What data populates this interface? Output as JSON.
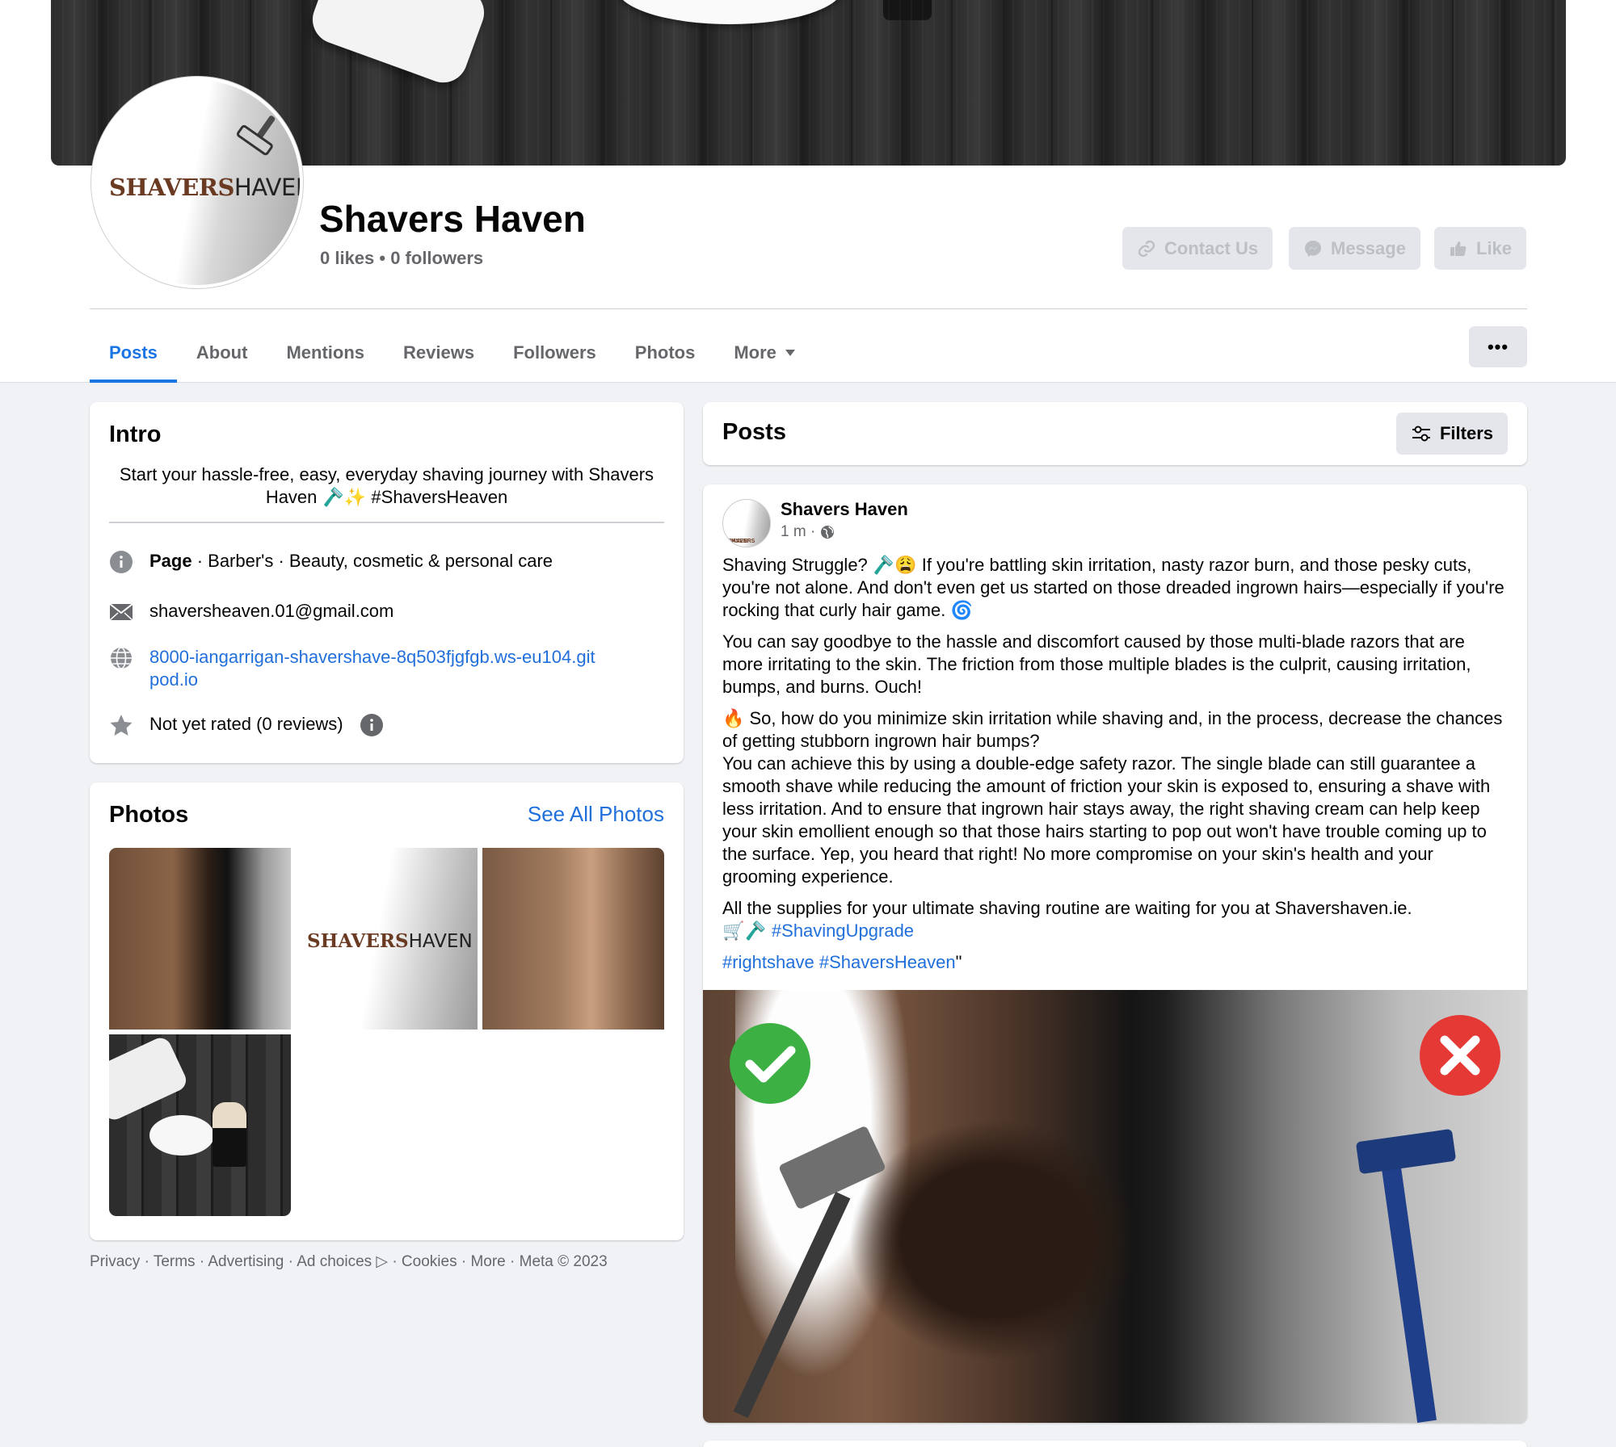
{
  "page": {
    "name": "Shavers Haven",
    "stats": "0 likes • 0 followers",
    "logo_text_1": "SHAVERS",
    "logo_text_2": "HAVEN"
  },
  "actions": {
    "contact": "Contact Us",
    "message": "Message",
    "like": "Like"
  },
  "tabs": [
    "Posts",
    "About",
    "Mentions",
    "Reviews",
    "Followers",
    "Photos",
    "More"
  ],
  "more_menu": "•••",
  "intro": {
    "title": "Intro",
    "bio": "Start your hassle-free, easy, everyday shaving journey with Shavers Haven 🪒✨ #ShaversHeaven",
    "category_label": "Page",
    "category": " · Barber's · Beauty, cosmetic & personal care",
    "email": "shaversheaven.01@gmail.com",
    "website": "8000-iangarrigan-shavershave-8q503fjgfgb.ws-eu104.gitpod.io",
    "rating": "Not yet rated (0 reviews)"
  },
  "photos": {
    "title": "Photos",
    "see_all": "See All Photos"
  },
  "footer": "Privacy · Terms · Advertising · Ad choices ▷ · Cookies · More · Meta © 2023",
  "posts_header": {
    "title": "Posts",
    "filters": "Filters"
  },
  "post": {
    "author": "Shavers Haven",
    "time": "1 m ·",
    "p1": "Shaving Struggle? 🪒😩 If you're battling skin irritation, nasty razor burn, and those pesky cuts, you're not alone. And don't even get us started on those dreaded ingrown hairs—especially if you're rocking that curly hair game. 🌀",
    "p2": "You can say goodbye to the hassle and discomfort caused by those multi-blade razors that are more irritating to the skin. The friction from those multiple blades is the culprit, causing irritation, bumps, and burns. Ouch!",
    "p3a": "🔥 So, how do you minimize skin irritation while shaving and, in the process, decrease the chances of getting stubborn ingrown hair bumps?",
    "p3b": "You can achieve this by using a double-edge safety razor. The single blade can still guarantee a smooth shave while reducing the amount of friction your skin is exposed to, ensuring a shave with less irritation. And to ensure that ingrown hair stays away, the right shaving cream can help keep your skin emollient enough so that those hairs starting to pop out won't have trouble coming up to the surface. Yep, you heard that right! No more compromise on your skin's health and your grooming experience.",
    "p4": "All the supplies for your ultimate shaving routine are waiting for you at Shavershaven.ie.",
    "p4_emoji": "🛒🪒 ",
    "hashtag_1": "#ShavingUpgrade",
    "hashtag_2": "#rightshave",
    "hashtag_3": "#ShaversHeaven",
    "trailing_quote": "\""
  },
  "colors": {
    "accent": "#1b74e4",
    "link": "#216fdb",
    "check_green": "#3cb043",
    "cross_red": "#e53935"
  }
}
